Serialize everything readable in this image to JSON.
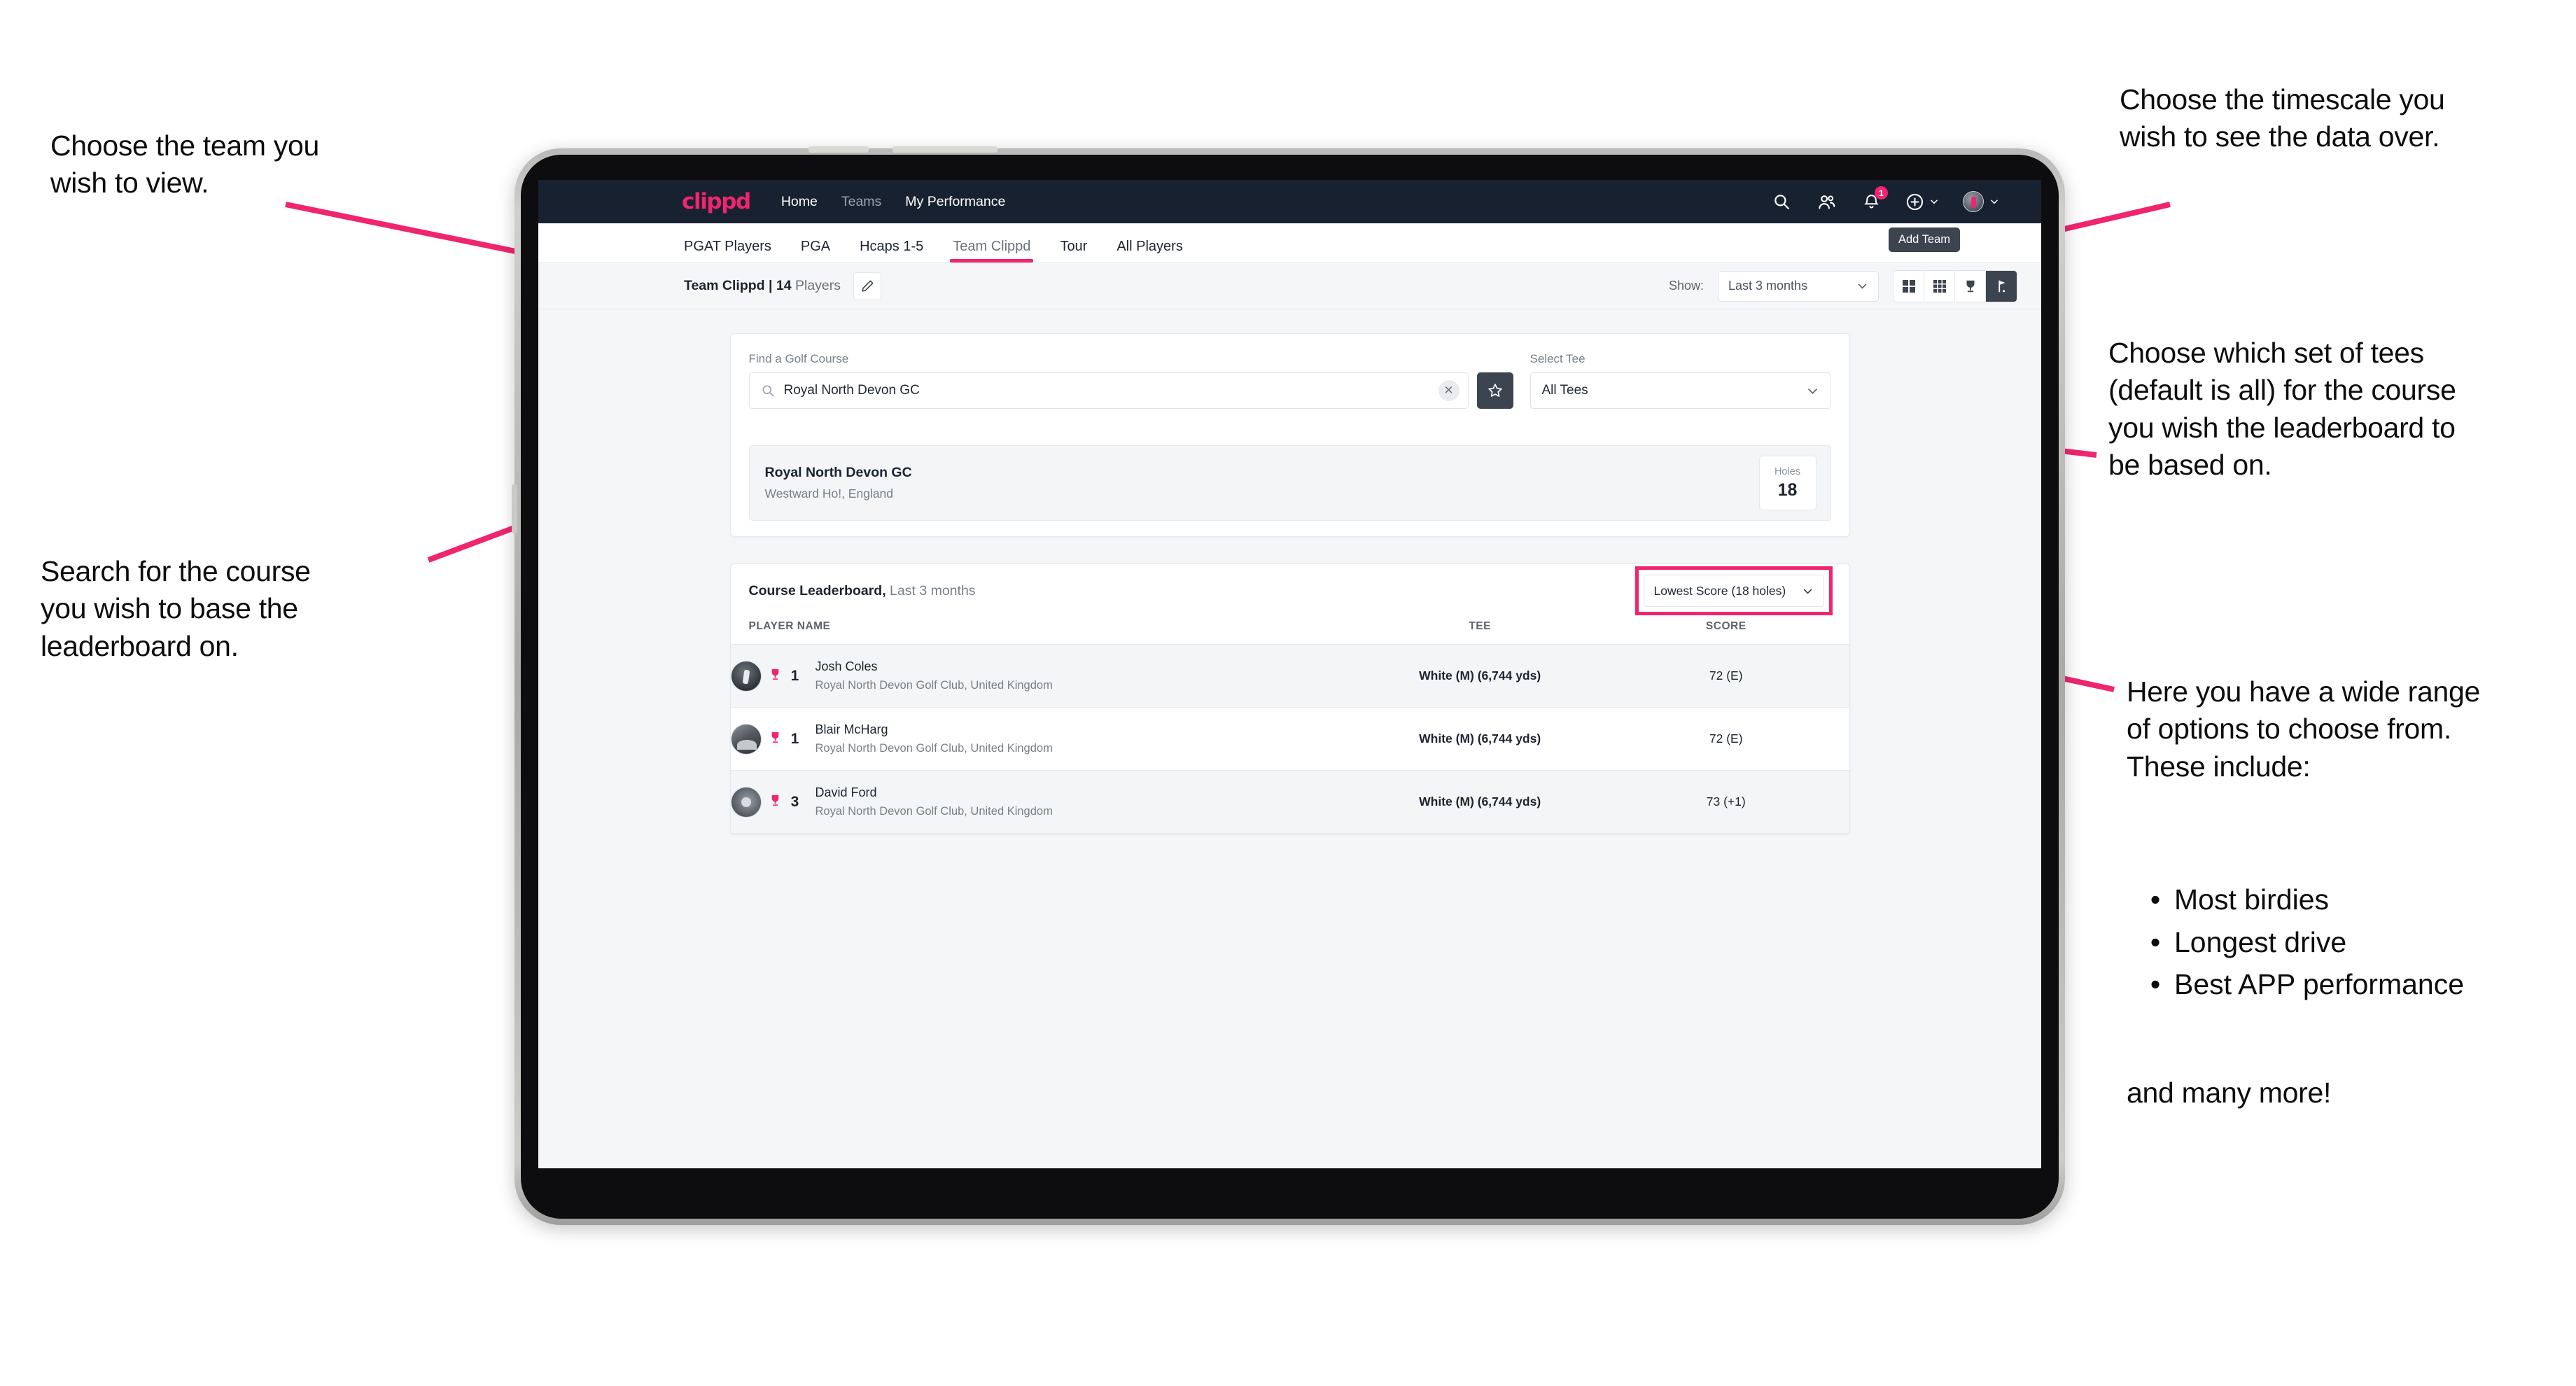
{
  "annotations": {
    "team": "Choose the team you\nwish to view.",
    "search": "Search for the course\nyou wish to base the\nleaderboard on.",
    "timescale": "Choose the timescale you\nwish to see the data over.",
    "tees": "Choose which set of tees\n(default is all) for the course\nyou wish the leaderboard to\nbe based on.",
    "options_intro": "Here you have a wide range\nof options to choose from.\nThese include:",
    "options_list": [
      "Most birdies",
      "Longest drive",
      "Best APP performance"
    ],
    "options_outro": "and many more!"
  },
  "app": {
    "navbar": {
      "logo": "clippd",
      "links": [
        {
          "label": "Home",
          "active": true
        },
        {
          "label": "Teams",
          "active": false
        },
        {
          "label": "My Performance",
          "active": true
        }
      ],
      "icons": [
        "search-icon",
        "people-icon",
        "bell-icon",
        "plus-icon",
        "avatar"
      ],
      "notification_count": "1"
    },
    "tabs": [
      {
        "label": "PGAT Players",
        "state": "normal"
      },
      {
        "label": "PGA",
        "state": "normal"
      },
      {
        "label": "Hcaps 1-5",
        "state": "normal"
      },
      {
        "label": "Team Clippd",
        "state": "active"
      },
      {
        "label": "Tour",
        "state": "normal"
      },
      {
        "label": "All Players",
        "state": "normal"
      }
    ],
    "tooltip": "Add Team",
    "toolbar": {
      "team_name": "Team Clippd",
      "separator": " | ",
      "player_count": "14",
      "players_word": " Players",
      "edit_icon": "pencil-icon",
      "show_label": "Show:",
      "timescale_value": "Last 3 months",
      "view_buttons": [
        "grid-2x2-icon",
        "grid-3x3-icon",
        "trophy-icon",
        "flag-icon"
      ],
      "active_view": "flag-icon"
    },
    "search_panel": {
      "course_label": "Find a Golf Course",
      "course_value": "Royal North Devon GC",
      "course_placeholder": "Find a Golf Course",
      "clear_icon": "close-icon",
      "star_icon": "star-icon",
      "tee_label": "Select Tee",
      "tee_value": "All Tees"
    },
    "course_result": {
      "name": "Royal North Devon GC",
      "location": "Westward Ho!, England",
      "holes_label": "Holes",
      "holes_value": "18"
    },
    "leaderboard": {
      "title": "Course Leaderboard,",
      "subtitle": " Last 3 months",
      "metric_value": "Lowest Score (18 holes)",
      "columns": [
        "PLAYER NAME",
        "TEE",
        "SCORE"
      ],
      "rows": [
        {
          "rank": "1",
          "name": "Josh Coles",
          "club": "Royal North Devon Golf Club, United Kingdom",
          "tee": "White (M) (6,744 yds)",
          "score": "72 (E)"
        },
        {
          "rank": "1",
          "name": "Blair McHarg",
          "club": "Royal North Devon Golf Club, United Kingdom",
          "tee": "White (M) (6,744 yds)",
          "score": "72 (E)"
        },
        {
          "rank": "3",
          "name": "David Ford",
          "club": "Royal North Devon Golf Club, United Kingdom",
          "tee": "White (M) (6,744 yds)",
          "score": "73 (+1)"
        }
      ]
    }
  },
  "colors": {
    "accent_pink": "#f0256f",
    "navbar_dark": "#172130",
    "page_bg": "#f4f6f8",
    "dark_button": "#3c4450"
  }
}
